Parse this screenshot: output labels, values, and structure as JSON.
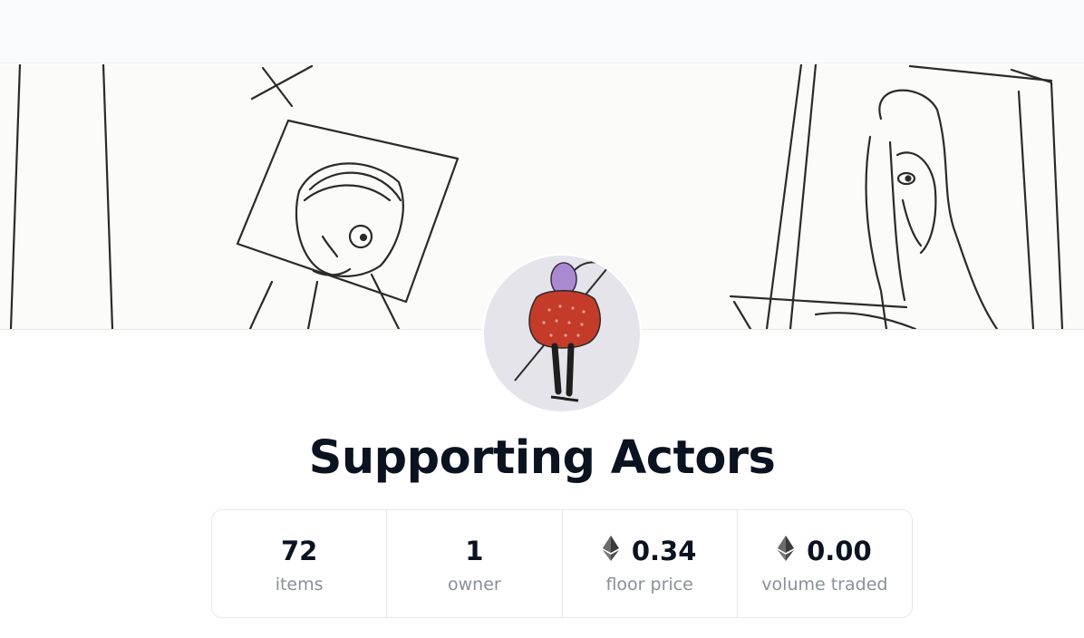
{
  "collection": {
    "title": "Supporting Actors",
    "banner_icon": "sketch-banner-image",
    "avatar_icon": "character-avatar-image"
  },
  "stats": [
    {
      "value": "72",
      "label": "items",
      "icon": null
    },
    {
      "value": "1",
      "label": "owner",
      "icon": null
    },
    {
      "value": "0.34",
      "label": "floor price",
      "icon": "ethereum-icon"
    },
    {
      "value": "0.00",
      "label": "volume traded",
      "icon": "ethereum-icon"
    }
  ],
  "colors": {
    "text": "#0b1220",
    "muted": "#8a8f98",
    "border": "#e5e7eb",
    "avatar_bg": "#e4e4ea"
  }
}
